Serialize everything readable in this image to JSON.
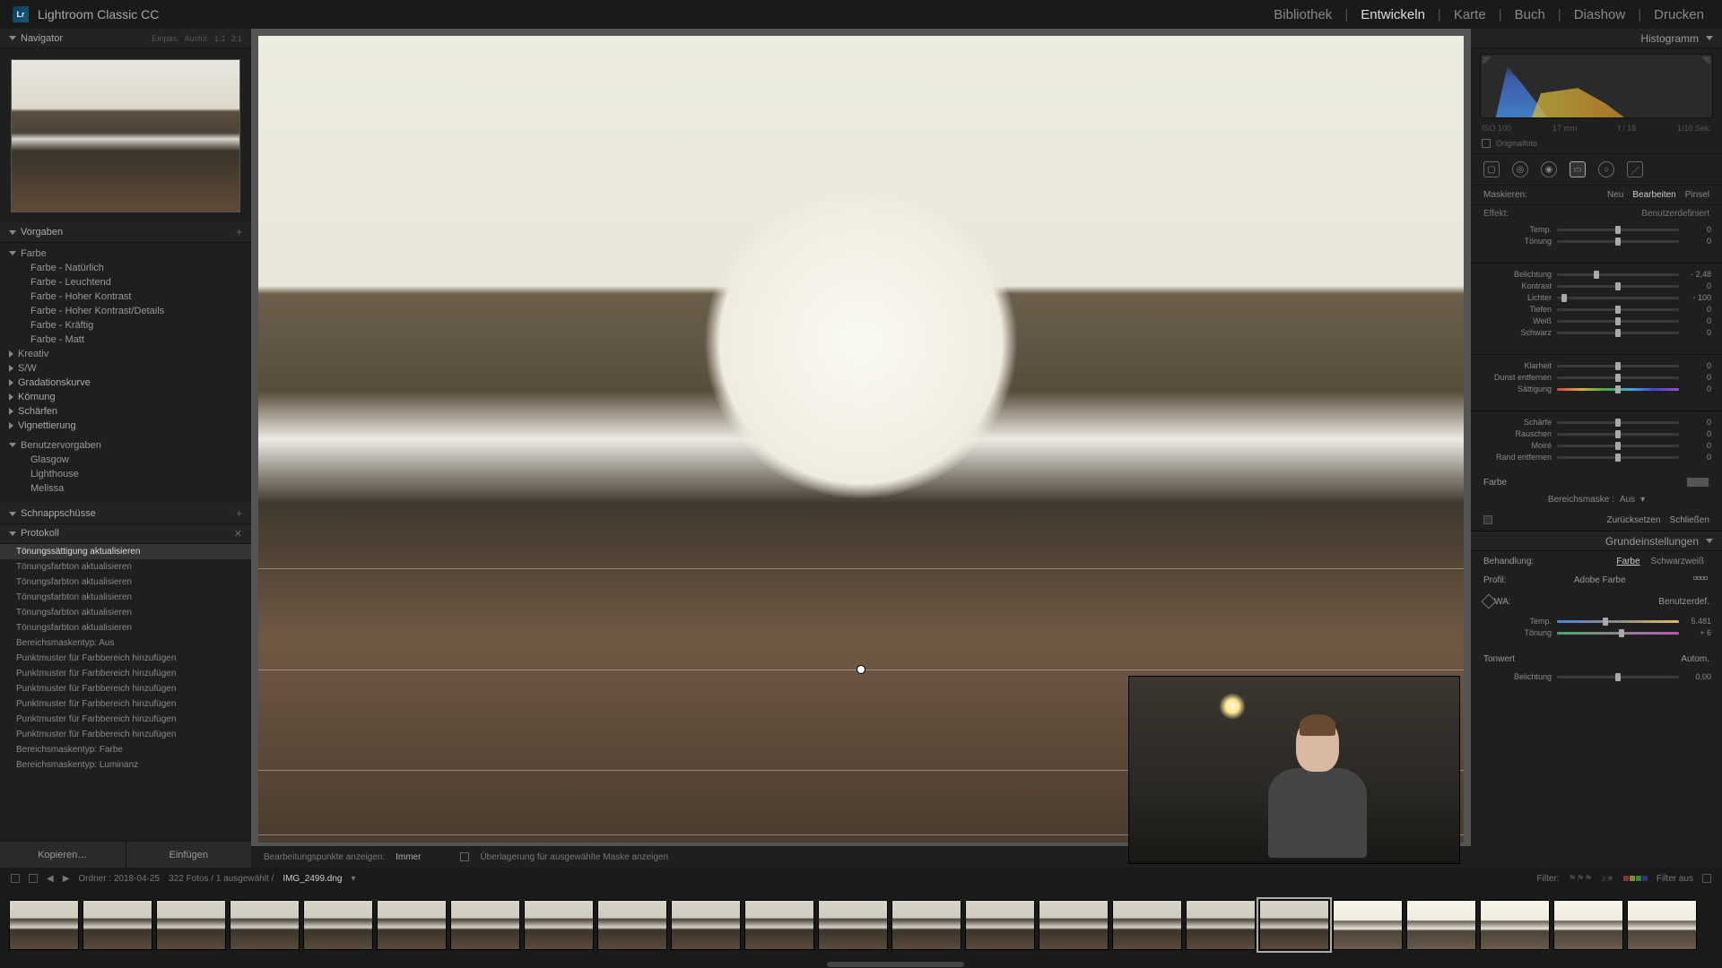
{
  "app": {
    "logo": "Lr",
    "title": "Lightroom Classic CC"
  },
  "modules": [
    "Bibliothek",
    "Entwickeln",
    "Karte",
    "Buch",
    "Diashow",
    "Drucken"
  ],
  "active_module_index": 1,
  "left": {
    "navigator": {
      "title": "Navigator",
      "zoom_opts": [
        "Einpas.",
        "Ausfül.",
        "1:1",
        "3:1"
      ]
    },
    "presets": {
      "title": "Vorgaben",
      "groups": [
        {
          "name": "Farbe",
          "expanded": true,
          "items": [
            "Farbe - Natürlich",
            "Farbe - Leuchtend",
            "Farbe - Hoher Kontrast",
            "Farbe - Hoher Kontrast/Details",
            "Farbe - Kräftig",
            "Farbe - Matt"
          ]
        },
        {
          "name": "Kreativ",
          "expanded": false,
          "items": []
        },
        {
          "name": "S/W",
          "expanded": false,
          "items": []
        }
      ],
      "sections": [
        "Gradationskurve",
        "Körnung",
        "Schärfen",
        "Vignettierung"
      ],
      "user": {
        "label": "Benutzervorgaben",
        "items": [
          "Glasgow",
          "Lighthouse",
          "Melissa"
        ]
      }
    },
    "snapshots": {
      "title": "Schnappschüsse"
    },
    "history": {
      "title": "Protokoll",
      "selected_index": 0,
      "items": [
        "Tönungssättigung aktualisieren",
        "Tönungsfarbton aktualisieren",
        "Tönungsfarbton aktualisieren",
        "Tönungsfarbton aktualisieren",
        "Tönungsfarbton aktualisieren",
        "Tönungsfarbton aktualisieren",
        "Bereichsmaskentyp: Aus",
        "Punktmuster für Farbbereich hinzufügen",
        "Punktmuster für Farbbereich hinzufügen",
        "Punktmuster für Farbbereich hinzufügen",
        "Punktmuster für Farbbereich hinzufügen",
        "Punktmuster für Farbbereich hinzufügen",
        "Punktmuster für Farbbereich hinzufügen",
        "Bereichsmaskentyp: Farbe",
        "Bereichsmaskentyp: Luminanz"
      ]
    },
    "btn_copy": "Kopieren…",
    "btn_paste": "Einfügen"
  },
  "center": {
    "toolbar_label": "Bearbeitungspunkte anzeigen:",
    "toolbar_mode": "Immer",
    "overlay_check": "Überlagerung für ausgewählte Maske anzeigen"
  },
  "right": {
    "histo_title": "Histogramm",
    "exif": {
      "iso": "ISO 100",
      "focal": "17 mm",
      "aperture": "f / 18",
      "shutter": "1/10 Sek."
    },
    "original": "Originalfoto",
    "mask": {
      "label": "Maskieren:",
      "tabs": [
        "Neu",
        "Bearbeiten",
        "Pinsel"
      ],
      "active_index": 1
    },
    "effect": {
      "label": "Effekt:",
      "value": "Benutzerdefiniert"
    },
    "sliders_a": [
      {
        "label": "Temp.",
        "pos": 50,
        "val": "0"
      },
      {
        "label": "Tönung",
        "pos": 50,
        "val": "0"
      }
    ],
    "sliders_b": [
      {
        "label": "Belichtung",
        "pos": 32,
        "val": "- 2,48"
      },
      {
        "label": "Kontrast",
        "pos": 50,
        "val": "0"
      },
      {
        "label": "Lichter",
        "pos": 6,
        "val": "- 100"
      },
      {
        "label": "Tiefen",
        "pos": 50,
        "val": "0"
      },
      {
        "label": "Weiß",
        "pos": 50,
        "val": "0"
      },
      {
        "label": "Schwarz",
        "pos": 50,
        "val": "0"
      }
    ],
    "sliders_c": [
      {
        "label": "Klarheit",
        "pos": 50,
        "val": "0"
      },
      {
        "label": "Dunst entfernen",
        "pos": 50,
        "val": "0"
      },
      {
        "label": "Sättigung",
        "pos": 50,
        "val": "0",
        "rainbow": true
      }
    ],
    "sliders_d": [
      {
        "label": "Schärfe",
        "pos": 50,
        "val": "0"
      },
      {
        "label": "Rauschen",
        "pos": 50,
        "val": "0"
      },
      {
        "label": "Moiré",
        "pos": 50,
        "val": "0"
      },
      {
        "label": "Rand entfernen",
        "pos": 50,
        "val": "0"
      }
    ],
    "color_label": "Farbe",
    "range_mask": {
      "label": "Bereichsmaske :",
      "value": "Aus"
    },
    "btn_reset": "Zurücksetzen",
    "btn_close": "Schließen",
    "basic": {
      "title": "Grundeinstellungen",
      "treatment": {
        "label": "Behandlung:",
        "opts": [
          "Farbe",
          "Schwarzweiß"
        ],
        "active": 0
      },
      "profile": {
        "label": "Profil:",
        "value": "Adobe Farbe"
      },
      "wb": {
        "label": "WA:",
        "value": "Benutzerdef."
      },
      "wb_sliders": [
        {
          "label": "Temp.",
          "pos": 40,
          "val": "5.481",
          "temp": true
        },
        {
          "label": "Tönung",
          "pos": 53,
          "val": "+ 6",
          "tint": true
        }
      ],
      "tone": {
        "label": "Tonwert",
        "auto": "Autom."
      },
      "exposure": {
        "label": "Belichtung",
        "pos": 50,
        "val": "0,00"
      }
    }
  },
  "infobar": {
    "folder": "Ordner : 2018-04-25",
    "count": "322 Fotos / 1 ausgewählt /",
    "filename": "IMG_2499.dng",
    "filter_label": "Filter:",
    "filter_off": "Filter aus"
  },
  "filmstrip": {
    "count": 23,
    "selected_index": 17
  }
}
